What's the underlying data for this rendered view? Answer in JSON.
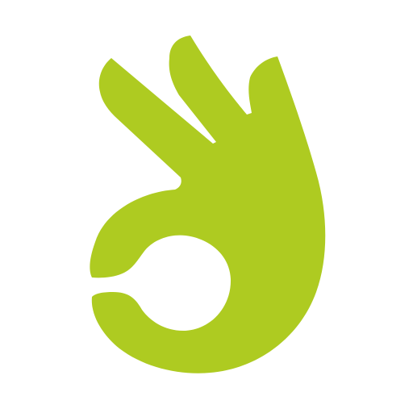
{
  "image": {
    "icon": "ok-hand-icon",
    "background": "#ffffff",
    "accent": "#aecb21"
  }
}
